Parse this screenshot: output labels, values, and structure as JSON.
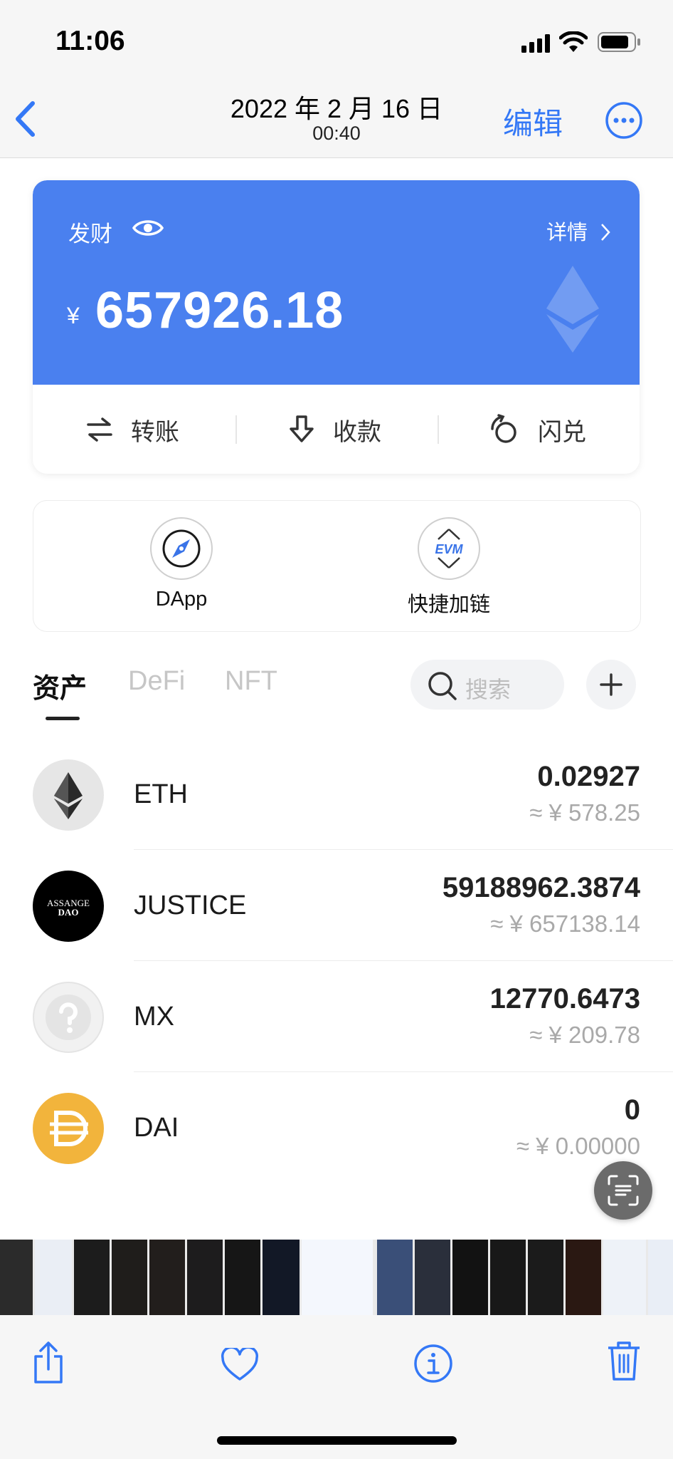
{
  "status_bar": {
    "time": "11:06"
  },
  "nav": {
    "title": "2022 年 2 月 16 日",
    "subtitle": "00:40",
    "edit_label": "编辑"
  },
  "wallet": {
    "name": "发财",
    "detail_label": "详情",
    "currency_symbol": "¥",
    "balance": "657926.18",
    "actions": [
      {
        "label": "转账",
        "icon": "transfer-icon"
      },
      {
        "label": "收款",
        "icon": "receive-icon"
      },
      {
        "label": "闪兑",
        "icon": "swap-icon"
      }
    ],
    "accent_color": "#4a80ef"
  },
  "quick_links": [
    {
      "label": "DApp",
      "icon": "compass-icon"
    },
    {
      "label": "快捷加链",
      "icon": "evm-icon",
      "icon_text": "EVM"
    }
  ],
  "tabs": [
    {
      "label": "资产",
      "active": true
    },
    {
      "label": "DeFi",
      "active": false
    },
    {
      "label": "NFT",
      "active": false
    }
  ],
  "search": {
    "placeholder": "搜索"
  },
  "assets": [
    {
      "symbol": "ETH",
      "balance": "0.02927",
      "fiat": "≈ ¥ 578.25",
      "logo": "eth-logo"
    },
    {
      "symbol": "JUSTICE",
      "balance": "59188962.3874",
      "fiat": "≈ ¥ 657138.14",
      "logo": "assange-dao-logo",
      "logo_text_1": "ASSANGE",
      "logo_text_2": "DAO"
    },
    {
      "symbol": "MX",
      "balance": "12770.6473",
      "fiat": "≈ ¥ 209.78",
      "logo": "unknown-token-logo"
    },
    {
      "symbol": "DAI",
      "balance": "0",
      "fiat": "≈ ¥ 0.00000",
      "logo": "dai-logo"
    }
  ],
  "toolbar": {
    "icons": [
      "share-icon",
      "heart-icon",
      "info-icon",
      "trash-icon"
    ]
  }
}
